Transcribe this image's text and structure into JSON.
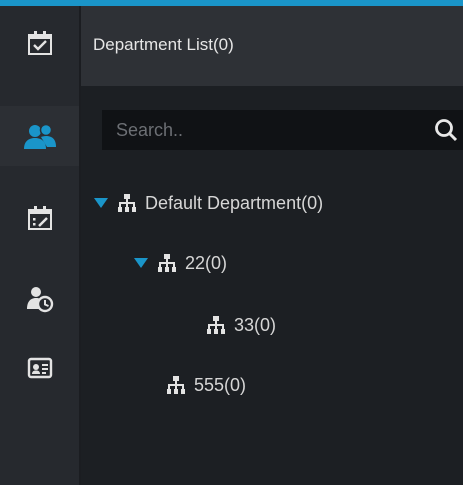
{
  "theme": {
    "accent": "#1a95c9",
    "icon_color": "#e3e3e3"
  },
  "sidebar": {
    "items": [
      {
        "id": "attendance",
        "icon": "calendar-check-icon"
      },
      {
        "id": "personnel",
        "icon": "users-icon",
        "active": true
      },
      {
        "id": "schedule",
        "icon": "calendar-edit-icon"
      },
      {
        "id": "user-time",
        "icon": "user-clock-icon"
      },
      {
        "id": "reports",
        "icon": "id-card-icon"
      }
    ]
  },
  "header": {
    "title": "Department List(0)"
  },
  "search": {
    "placeholder": "Search..",
    "value": ""
  },
  "tree": {
    "nodes": [
      {
        "label": "Default Department(0)",
        "level": 0,
        "expanded": true
      },
      {
        "label": "22(0)",
        "level": 1,
        "expanded": true
      },
      {
        "label": "33(0)",
        "level": 2
      },
      {
        "label": "555(0)",
        "level": 1
      }
    ]
  }
}
